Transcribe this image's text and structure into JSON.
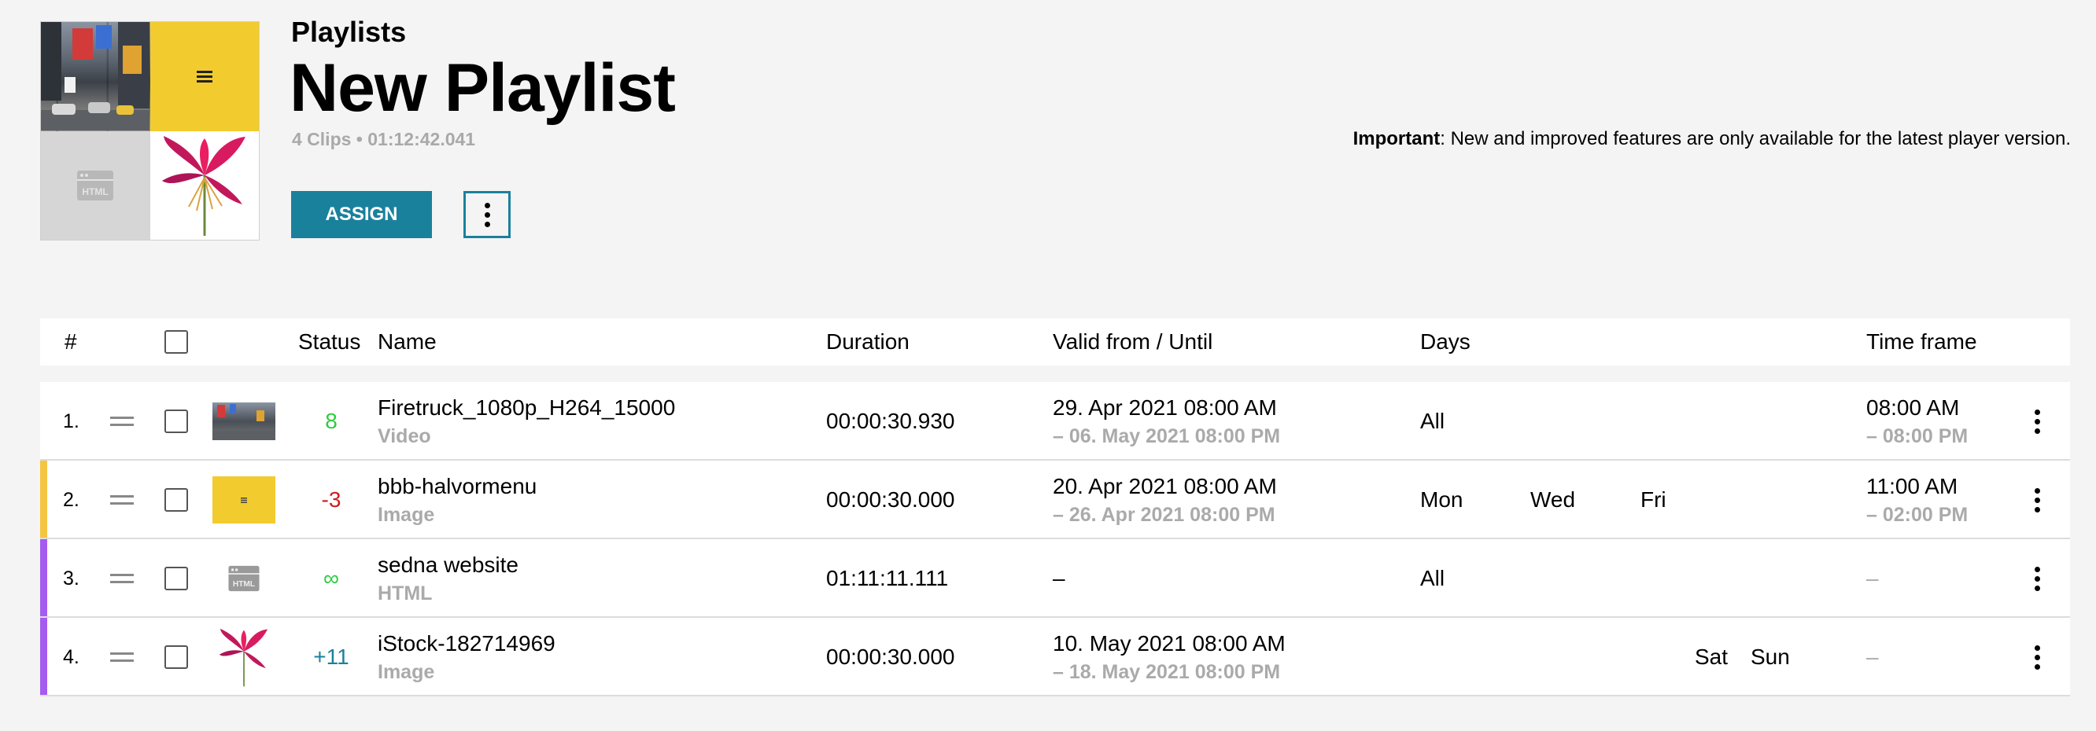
{
  "header": {
    "breadcrumb": "Playlists",
    "title": "New Playlist",
    "meta": "4 Clips • 01:12:42.041",
    "assign_label": "ASSIGN",
    "notice_bold": "Important",
    "notice_text": ": New and improved features are only available for the latest player version.",
    "thumb_html_label": "HTML"
  },
  "table": {
    "columns": {
      "index": "#",
      "status": "Status",
      "name": "Name",
      "duration": "Duration",
      "valid": "Valid from / Until",
      "days": "Days",
      "timeframe": "Time frame"
    },
    "rows": [
      {
        "index": "1.",
        "accent": "",
        "thumb": "city",
        "status": "8",
        "status_color": "#2ecc40",
        "name": "Firetruck_1080p_H264_15000",
        "type": "Video",
        "duration": "00:00:30.930",
        "valid_from": "29. Apr 2021 08:00 AM",
        "valid_until": "– 06. May 2021 08:00 PM",
        "days": [
          "All",
          "",
          "",
          "",
          "",
          "",
          ""
        ],
        "time_from": "08:00 AM",
        "time_until": "– 08:00 PM"
      },
      {
        "index": "2.",
        "accent": "#f5c542",
        "thumb": "yellow",
        "status": "-3",
        "status_color": "#cc1f1f",
        "name": "bbb-halvormenu",
        "type": "Image",
        "duration": "00:00:30.000",
        "valid_from": "20. Apr 2021 08:00 AM",
        "valid_until": "– 26. Apr 2021 08:00 PM",
        "days": [
          "Mon",
          "Wed",
          "Fri",
          "",
          "",
          "",
          ""
        ],
        "time_from": "11:00 AM",
        "time_until": "– 02:00 PM"
      },
      {
        "index": "3.",
        "accent": "#a45cf0",
        "thumb": "html",
        "status": "∞",
        "status_color": "#2ecc40",
        "name": "sedna website",
        "type": "HTML",
        "duration": "01:11:11.111",
        "valid_from": "–",
        "valid_until": "",
        "days": [
          "All",
          "",
          "",
          "",
          "",
          "",
          ""
        ],
        "time_from": "–",
        "time_until": ""
      },
      {
        "index": "4.",
        "accent": "#a45cf0",
        "thumb": "flower",
        "status": "+11",
        "status_color": "#1a819c",
        "name": "iStock-182714969",
        "type": "Image",
        "duration": "00:00:30.000",
        "valid_from": "10. May 2021 08:00 AM",
        "valid_until": "– 18. May 2021 08:00 PM",
        "days": [
          "",
          "",
          "",
          "Sat",
          "Sun",
          "",
          ""
        ],
        "time_from": "–",
        "time_until": ""
      }
    ]
  }
}
